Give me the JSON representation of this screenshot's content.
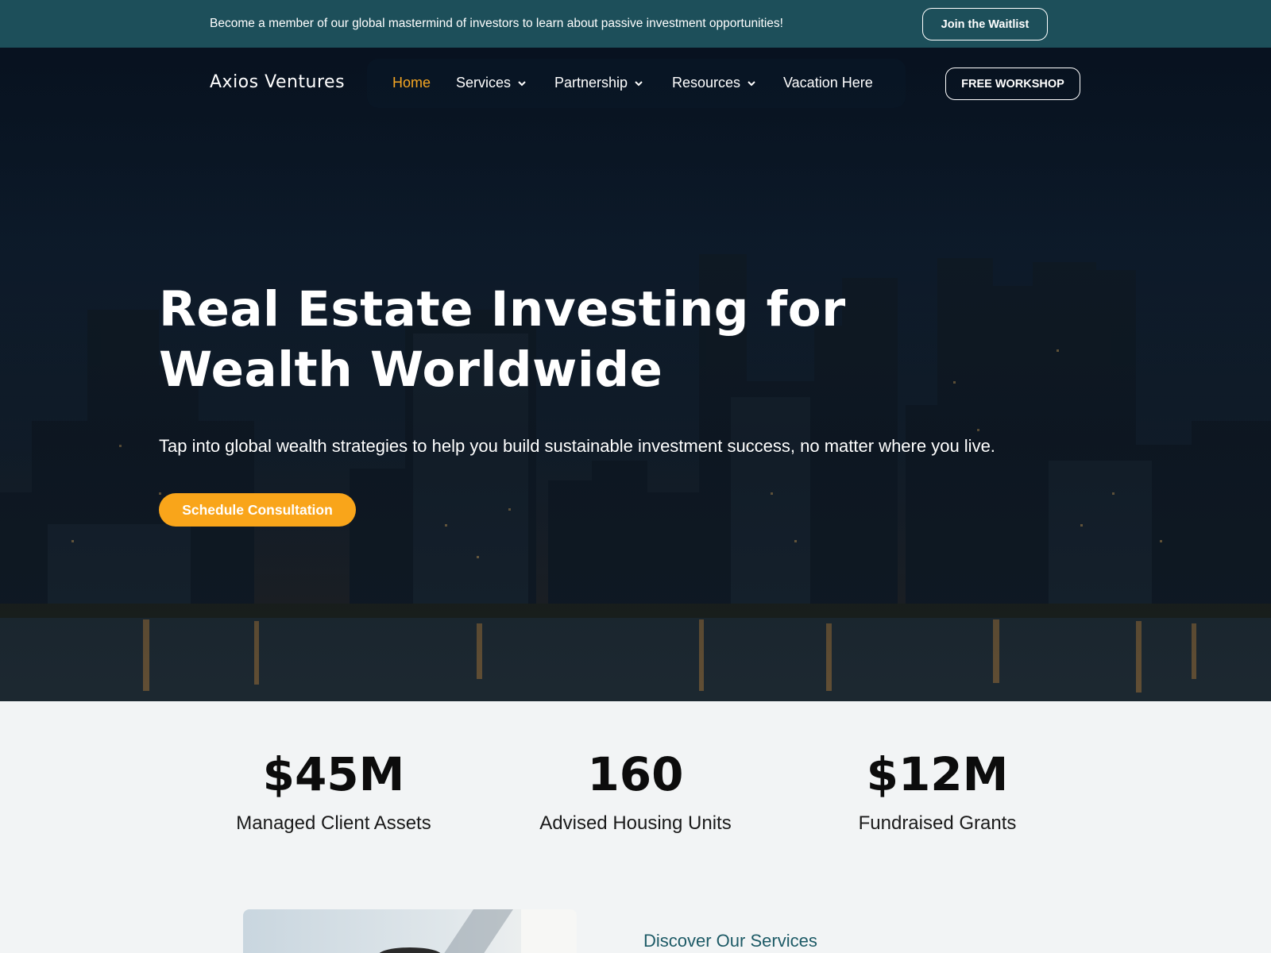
{
  "topbar": {
    "message": "Become a member of our global mastermind of investors to learn about passive investment opportunities!",
    "cta_label": "Join the Waitlist"
  },
  "nav": {
    "logo": "Axios Ventures",
    "items": [
      {
        "label": "Home",
        "active": true,
        "dropdown": false
      },
      {
        "label": "Services",
        "active": false,
        "dropdown": true
      },
      {
        "label": "Partnership",
        "active": false,
        "dropdown": true
      },
      {
        "label": "Resources",
        "active": false,
        "dropdown": true
      },
      {
        "label": "Vacation Here",
        "active": false,
        "dropdown": false
      }
    ],
    "workshop_label": "FREE WORKSHOP"
  },
  "hero": {
    "title": "Real Estate Investing for Wealth Worldwide",
    "subtitle": "Tap into global wealth strategies to help you build sustainable investment success, no matter where you live.",
    "cta_label": "Schedule Consultation"
  },
  "stats": [
    {
      "value": "$45M",
      "label": "Managed Client Assets"
    },
    {
      "value": "160",
      "label": "Advised Housing Units"
    },
    {
      "value": "$12M",
      "label": "Fundraised Grants"
    }
  ],
  "services": {
    "heading": "Discover Our Services"
  },
  "colors": {
    "topbar_bg": "#1d4f5a",
    "accent": "#f9a51a",
    "active_nav": "#f5a623",
    "page_bg": "#f2f4f5",
    "services_heading": "#1d5a66"
  }
}
